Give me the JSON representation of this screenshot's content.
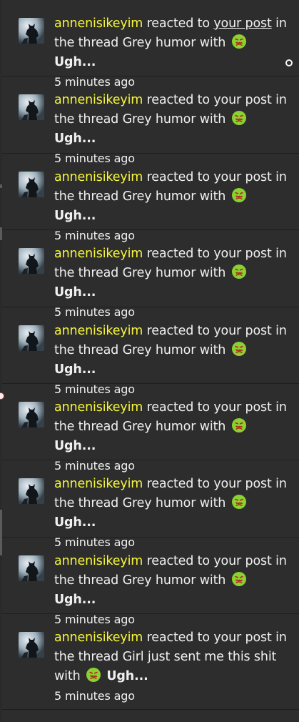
{
  "theme": {
    "background": "#2d2d2d",
    "text": "#f0f0f0",
    "username": "#f7f73a",
    "divider": "#1f1f1f",
    "emoji_face": "#8bd12f",
    "emoji_feature": "#b32323"
  },
  "notifications": [
    {
      "username": "annenisikeyim",
      "action": "reacted to",
      "link": "your post",
      "mid": "in the thread",
      "thread": "Grey humor",
      "with_text": "with",
      "reaction_icon": "sick-face-icon",
      "reaction": "Ugh...",
      "time": "5 minutes ago",
      "unread_marker_icon": "circle-icon"
    },
    {
      "username": "annenisikeyim",
      "action": "reacted to",
      "link": "your post",
      "mid": "in the thread",
      "thread": "Grey humor",
      "with_text": "with",
      "reaction_icon": "sick-face-icon",
      "reaction": "Ugh...",
      "time": "5 minutes ago"
    },
    {
      "username": "annenisikeyim",
      "action": "reacted to",
      "link": "your post",
      "mid": "in the thread",
      "thread": "Grey humor",
      "with_text": "with",
      "reaction_icon": "sick-face-icon",
      "reaction": "Ugh...",
      "time": "5 minutes ago"
    },
    {
      "username": "annenisikeyim",
      "action": "reacted to",
      "link": "your post",
      "mid": "in the thread",
      "thread": "Grey humor",
      "with_text": "with",
      "reaction_icon": "sick-face-icon",
      "reaction": "Ugh...",
      "time": "5 minutes ago"
    },
    {
      "username": "annenisikeyim",
      "action": "reacted to",
      "link": "your post",
      "mid": "in the thread",
      "thread": "Grey humor",
      "with_text": "with",
      "reaction_icon": "sick-face-icon",
      "reaction": "Ugh...",
      "time": "5 minutes ago"
    },
    {
      "username": "annenisikeyim",
      "action": "reacted to",
      "link": "your post",
      "mid": "in the thread",
      "thread": "Grey humor",
      "with_text": "with",
      "reaction_icon": "sick-face-icon",
      "reaction": "Ugh...",
      "time": "5 minutes ago"
    },
    {
      "username": "annenisikeyim",
      "action": "reacted to",
      "link": "your post",
      "mid": "in the thread",
      "thread": "Grey humor",
      "with_text": "with",
      "reaction_icon": "sick-face-icon",
      "reaction": "Ugh...",
      "time": "5 minutes ago"
    },
    {
      "username": "annenisikeyim",
      "action": "reacted to",
      "link": "your post",
      "mid": "in the thread",
      "thread": "Grey humor",
      "with_text": "with",
      "reaction_icon": "sick-face-icon",
      "reaction": "Ugh...",
      "time": "5 minutes ago"
    },
    {
      "username": "annenisikeyim",
      "action": "reacted to",
      "link": "your post",
      "mid": "in the thread",
      "thread": "Girl just sent me this shit",
      "with_text": "with",
      "reaction_icon": "sick-face-icon",
      "reaction": "Ugh...",
      "time": "5 minutes ago"
    }
  ]
}
